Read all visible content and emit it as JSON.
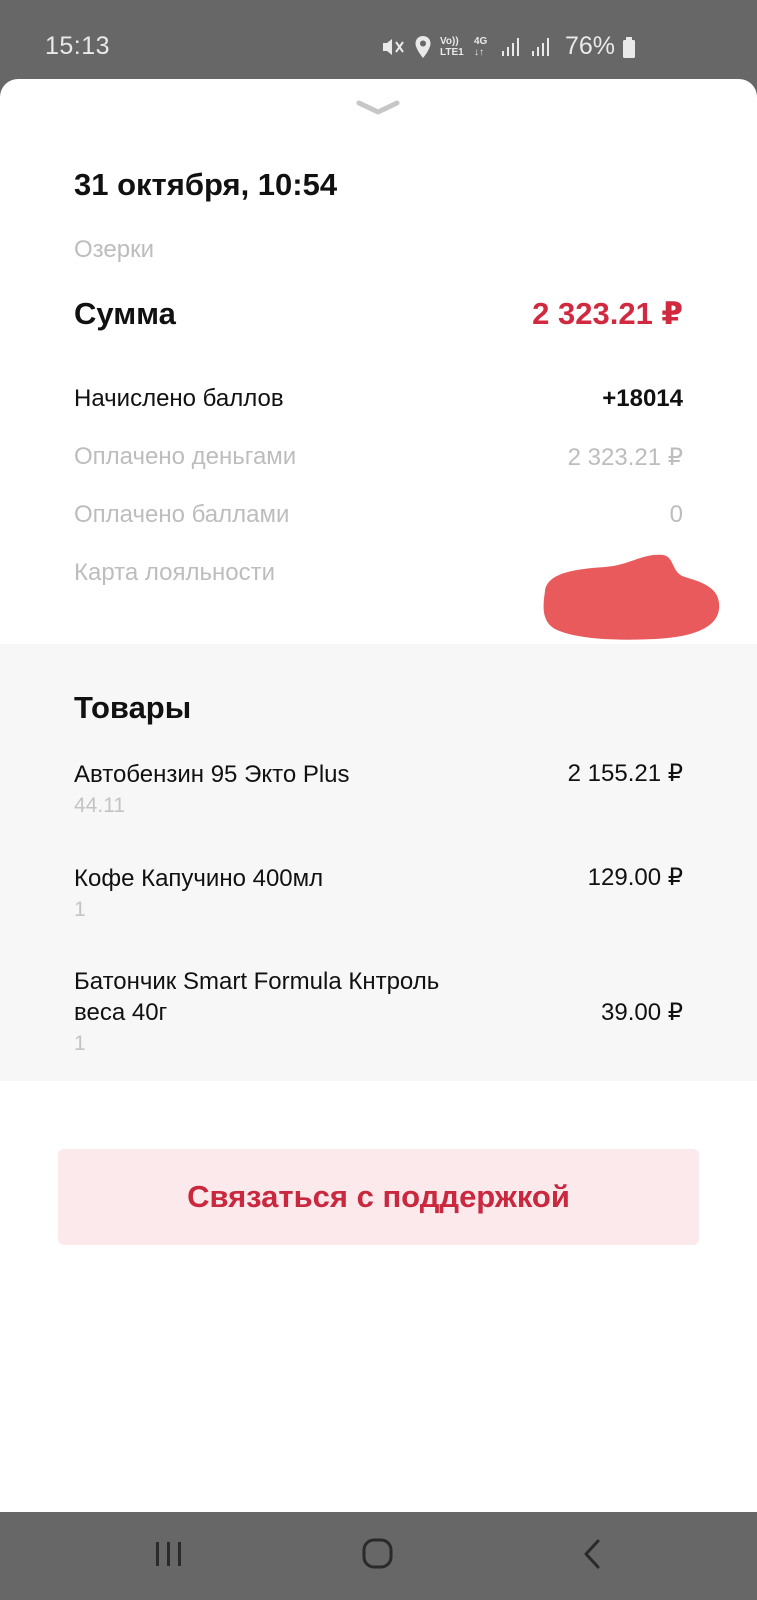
{
  "status_bar": {
    "time": "15:13",
    "battery": "76%",
    "icons": [
      "mute-icon",
      "location-icon",
      "volte-icon",
      "4g-icon",
      "signal-icon",
      "signal-icon",
      "battery-icon"
    ],
    "volte_label": "Vo)) LTE1",
    "network_label": "4G"
  },
  "receipt": {
    "datetime": "31 октября, 10:54",
    "station": "Озерки",
    "sum_label": "Сумма",
    "sum_value": "2 323.21 ₽",
    "rows": [
      {
        "label": "Начислено баллов",
        "value": "+18014"
      },
      {
        "label": "Оплачено деньгами",
        "value": "2 323.21 ₽"
      },
      {
        "label": "Оплачено баллами",
        "value": "0"
      },
      {
        "label": "Карта лояльности",
        "value": ""
      }
    ]
  },
  "products": {
    "title": "Товары",
    "items": [
      {
        "name": "Автобензин 95 Экто Plus",
        "qty": "44.11",
        "price": "2 155.21 ₽"
      },
      {
        "name": "Кофе Капучино 400мл",
        "qty": "1",
        "price": "129.00 ₽"
      },
      {
        "name": "Батончик Smart Formula Кнтроль веса 40г",
        "qty": "1",
        "price": "39.00 ₽"
      }
    ]
  },
  "support_button": "Связаться с поддержкой",
  "colors": {
    "accent": "#d1293f",
    "button_bg": "#fbe9eb",
    "redaction": "#e85a5c",
    "muted_text": "#bdbdbd",
    "section_bg": "#f7f7f7"
  },
  "nav": {
    "icons": [
      "recent-apps-icon",
      "home-icon",
      "back-icon"
    ]
  }
}
